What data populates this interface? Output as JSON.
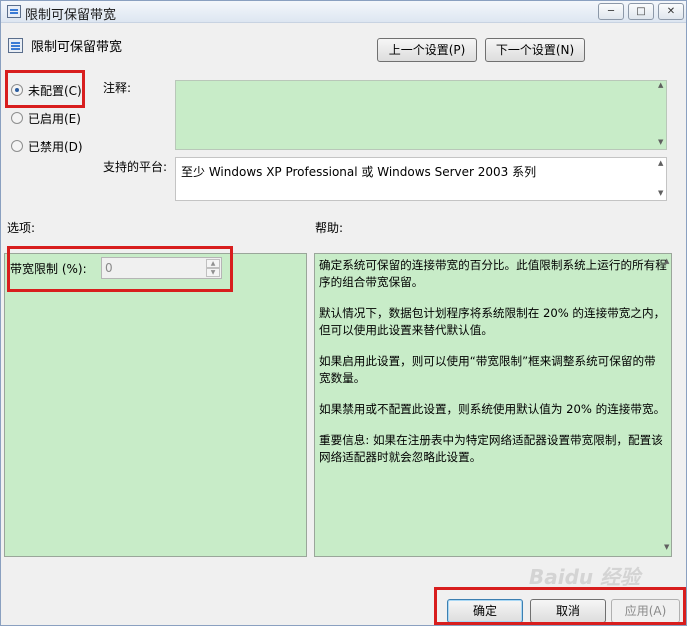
{
  "window": {
    "title": "限制可保留带宽",
    "controls": {
      "minimize": "─",
      "maximize": "□",
      "close": "✕"
    }
  },
  "header": {
    "title": "限制可保留带宽",
    "prev_button": "上一个设置(P)",
    "next_button": "下一个设置(N)"
  },
  "state": {
    "options": [
      {
        "label": "未配置(C)",
        "selected": true
      },
      {
        "label": "已启用(E)",
        "selected": false
      },
      {
        "label": "已禁用(D)",
        "selected": false
      }
    ]
  },
  "comment": {
    "label": "注释:",
    "value": ""
  },
  "platform": {
    "label": "支持的平台:",
    "value": "至少 Windows XP Professional 或 Windows Server 2003 系列"
  },
  "options_section": {
    "label": "选项:",
    "bandwidth_label": "带宽限制 (%):",
    "bandwidth_value": "0"
  },
  "help_section": {
    "label": "帮助:",
    "paragraphs": [
      "确定系统可保留的连接带宽的百分比。此值限制系统上运行的所有程序的组合带宽保留。",
      "默认情况下，数据包计划程序将系统限制在 20% 的连接带宽之内，但可以使用此设置来替代默认值。",
      "如果启用此设置，则可以使用“带宽限制”框来调整系统可保留的带宽数量。",
      "如果禁用或不配置此设置，则系统使用默认值为 20% 的连接带宽。",
      "重要信息: 如果在注册表中为特定网络适配器设置带宽限制，配置该网络适配器时就会忽略此设置。"
    ]
  },
  "footer": {
    "ok_button": "确定",
    "cancel_button": "取消",
    "apply_button": "应用(A)"
  },
  "watermark": "Baidu 经验",
  "colors": {
    "panel_green": "#c8ecc8",
    "highlight_red": "#d81e1e",
    "window_bg": "#f0f0f0"
  }
}
